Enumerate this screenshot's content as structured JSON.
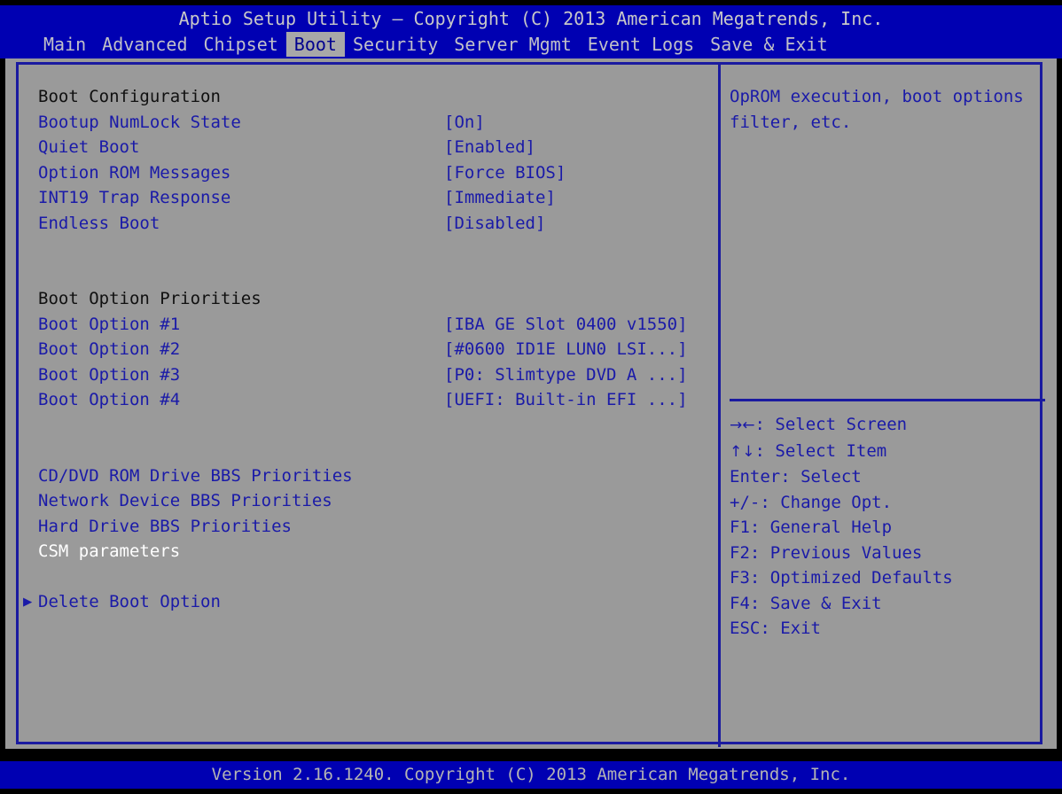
{
  "header": {
    "title": "Aptio Setup Utility – Copyright (C) 2013 American Megatrends, Inc.",
    "tabs": [
      {
        "label": "Main",
        "active": false
      },
      {
        "label": "Advanced",
        "active": false
      },
      {
        "label": "Chipset",
        "active": false
      },
      {
        "label": "Boot",
        "active": true
      },
      {
        "label": "Security",
        "active": false
      },
      {
        "label": "Server Mgmt",
        "active": false
      },
      {
        "label": "Event Logs",
        "active": false
      },
      {
        "label": "Save & Exit",
        "active": false
      }
    ]
  },
  "settings": {
    "boot_configuration_heading": "Boot Configuration",
    "items": [
      {
        "label": "Bootup NumLock State",
        "value": "[On]"
      },
      {
        "label": "Quiet Boot",
        "value": "[Enabled]"
      },
      {
        "label": "Option ROM Messages",
        "value": "[Force BIOS]"
      },
      {
        "label": "INT19 Trap Response",
        "value": "[Immediate]"
      },
      {
        "label": "Endless Boot",
        "value": "[Disabled]"
      }
    ],
    "boot_priorities_heading": "Boot Option Priorities",
    "boot_options": [
      {
        "label": "Boot Option #1",
        "value": "[IBA GE Slot 0400 v1550]"
      },
      {
        "label": "Boot Option #2",
        "value": "[#0600 ID1E LUN0 LSI...]"
      },
      {
        "label": "Boot Option #3",
        "value": "[P0: Slimtype DVD A ...]"
      },
      {
        "label": "Boot Option #4",
        "value": "[UEFI: Built-in EFI ...]"
      }
    ],
    "submenus": [
      {
        "label": "CD/DVD ROM Drive BBS Priorities",
        "selected": false
      },
      {
        "label": "Network Device BBS Priorities",
        "selected": false
      },
      {
        "label": "Hard Drive BBS Priorities",
        "selected": false
      },
      {
        "label": "CSM parameters",
        "selected": true
      }
    ],
    "delete_boot_option": {
      "label": "Delete Boot Option",
      "bullet": "triangle-right-icon"
    }
  },
  "help": {
    "description": "OpROM execution, boot options filter, etc.",
    "keys": [
      {
        "glyph": "→←",
        "text": ": Select Screen"
      },
      {
        "glyph": "↑↓",
        "text": ": Select Item"
      },
      {
        "glyph": "",
        "text": "Enter: Select"
      },
      {
        "glyph": "",
        "text": "+/-: Change Opt."
      },
      {
        "glyph": "",
        "text": "F1: General Help"
      },
      {
        "glyph": "",
        "text": "F2: Previous Values"
      },
      {
        "glyph": "",
        "text": "F3: Optimized Defaults"
      },
      {
        "glyph": "",
        "text": "F4: Save & Exit"
      },
      {
        "glyph": "",
        "text": "ESC: Exit"
      }
    ]
  },
  "footer": {
    "version": "Version 2.16.1240. Copyright (C) 2013 American Megatrends, Inc."
  },
  "colors": {
    "blue_background": "#0000b2",
    "gray_panel": "#9a9a9a",
    "text_blue": "#1a1aa8",
    "text_heading": "#101010",
    "text_selected": "#ffffff",
    "band_text": "#c8c8c8"
  }
}
